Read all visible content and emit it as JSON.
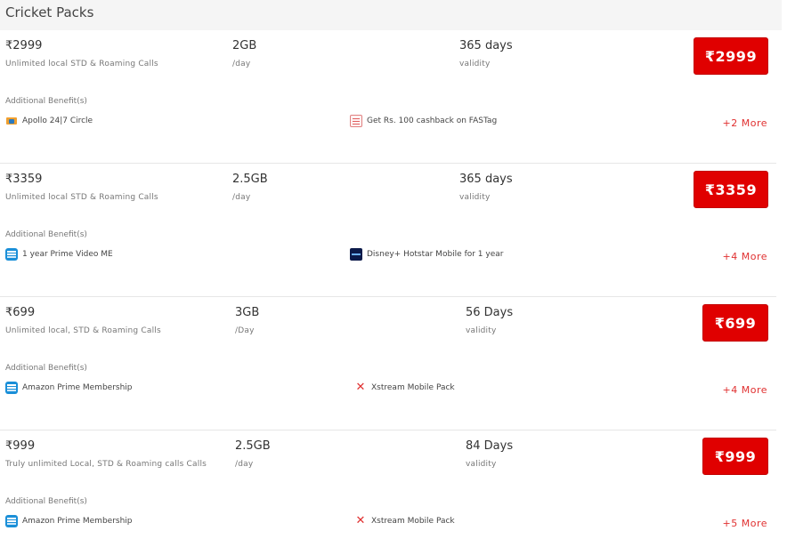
{
  "header": {
    "title": "Cricket Packs"
  },
  "common": {
    "additional_benefits": "Additional Benefit(s)"
  },
  "packs": [
    {
      "price": "₹2999",
      "calls": "Unlimited local STD & Roaming Calls",
      "data": "2GB",
      "data_unit": "/day",
      "validity": "365 days",
      "validity_label": "validity",
      "button_label": "₹2999",
      "benefits": [
        {
          "icon": "apollo-icon",
          "label": "Apollo 24|7 Circle"
        },
        {
          "icon": "fastag-icon",
          "label": "Get Rs. 100 cashback on FASTag"
        }
      ],
      "more": "+2 More"
    },
    {
      "price": "₹3359",
      "calls": "Unlimited local STD & Roaming Calls",
      "data": "2.5GB",
      "data_unit": "/day",
      "validity": "365 days",
      "validity_label": "validity",
      "button_label": "₹3359",
      "benefits": [
        {
          "icon": "prime-video-icon",
          "label": "1 year Prime Video ME"
        },
        {
          "icon": "hotstar-icon",
          "label": "Disney+ Hotstar Mobile for 1 year"
        }
      ],
      "more": "+4 More"
    },
    {
      "price": "₹699",
      "calls": "Unlimited local, STD & Roaming Calls",
      "data": "3GB",
      "data_unit": "/Day",
      "validity": "56 Days",
      "validity_label": "validity",
      "button_label": "₹699",
      "benefits": [
        {
          "icon": "amazon-prime-icon",
          "label": "Amazon Prime Membership"
        },
        {
          "icon": "xstream-icon",
          "label": "Xstream Mobile Pack"
        }
      ],
      "more": "+4 More"
    },
    {
      "price": "₹999",
      "calls": "Truly unlimited Local, STD & Roaming calls Calls",
      "data": "2.5GB",
      "data_unit": "/day",
      "validity": "84 Days",
      "validity_label": "validity",
      "button_label": "₹999",
      "benefits": [
        {
          "icon": "amazon-prime-icon",
          "label": "Amazon Prime Membership"
        },
        {
          "icon": "xstream-icon",
          "label": "Xstream Mobile Pack"
        }
      ],
      "more": "+5 More"
    }
  ],
  "colors": {
    "accent": "#e00000",
    "link": "#e03030"
  }
}
